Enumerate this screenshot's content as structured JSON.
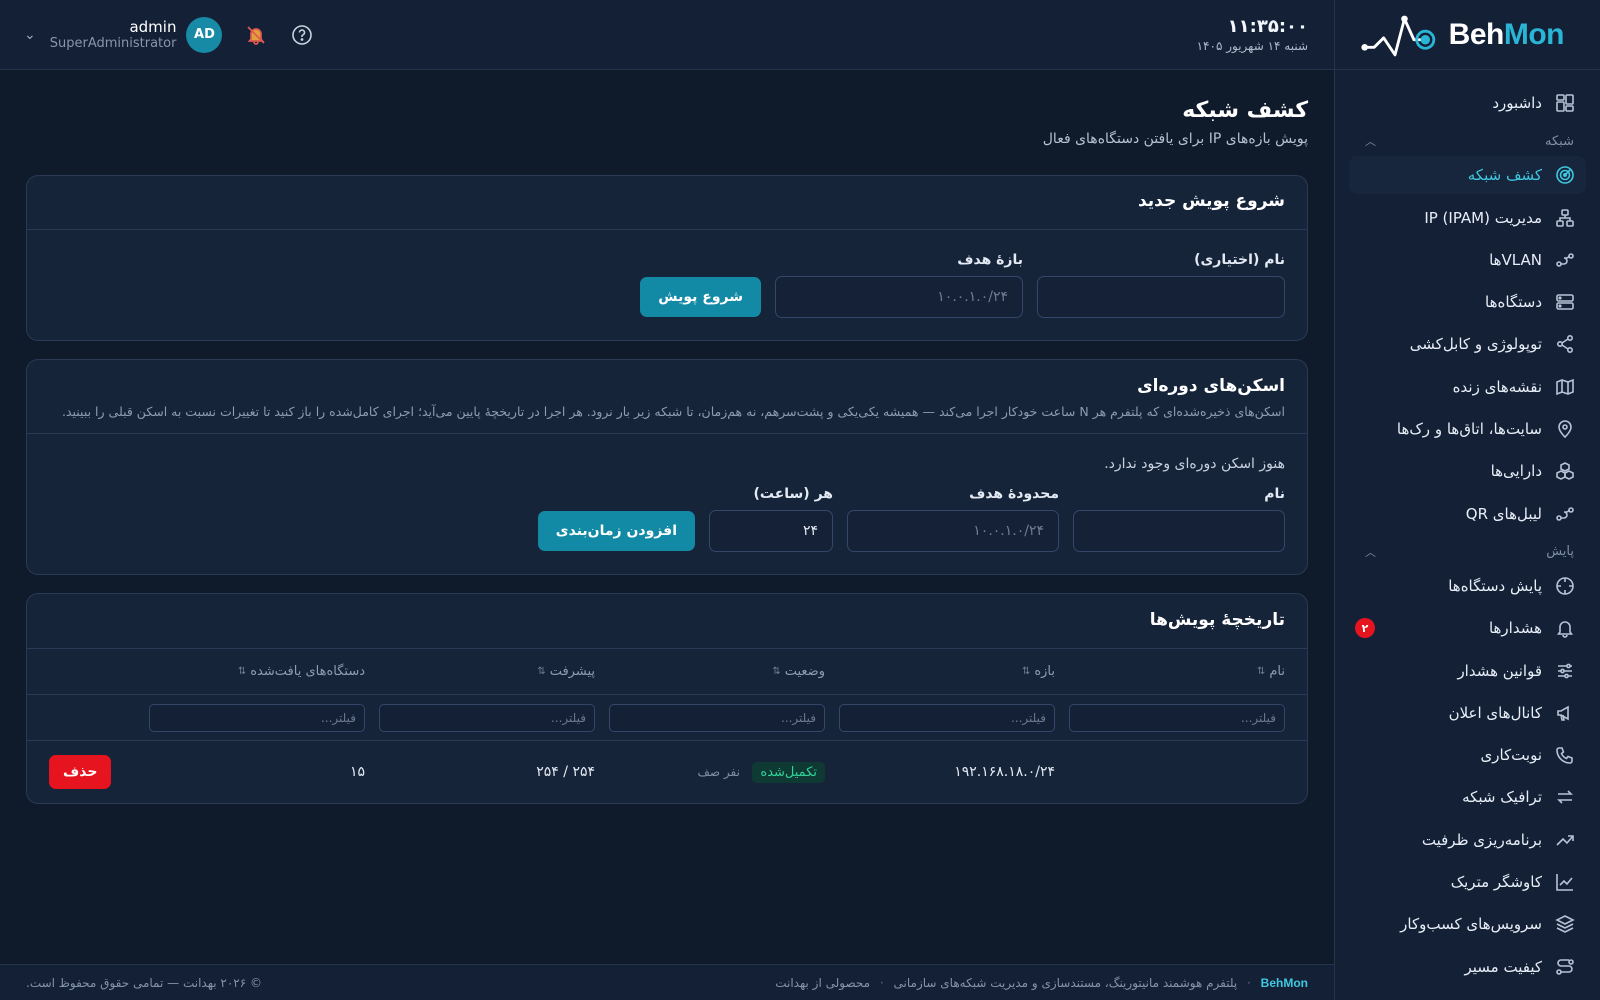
{
  "brand": {
    "part1": "Beh",
    "part2": "Mon"
  },
  "clock": {
    "time": "۱۱:۳۵:۰۰",
    "date": "شنبه ۱۴ شهریور ۱۴۰۵"
  },
  "user": {
    "name": "admin",
    "role": "SuperAdministrator",
    "initials": "AD"
  },
  "nav": {
    "dashboard": "داشبورد",
    "section_network": "شبکه",
    "network_discovery": "کشف شبکه",
    "ipam": "مدیریت IP (IPAM)",
    "vlans": "VLANها",
    "devices": "دستگاه‌ها",
    "topology": "توپولوژی و کابل‌کشی",
    "live_maps": "نقشه‌های زنده",
    "sites": "سایت‌ها، اتاق‌ها و رک‌ها",
    "assets": "دارایی‌ها",
    "qr_labels": "لیبل‌های QR",
    "section_monitoring": "پایش",
    "device_monitoring": "پایش دستگاه‌ها",
    "alerts": "هشدارها",
    "alerts_badge": "۲",
    "alert_rules": "قوانین هشدار",
    "notif_channels": "کانال‌های اعلان",
    "oncall": "نوبت‌کاری",
    "traffic": "ترافیک شبکه",
    "capacity": "برنامه‌ریزی ظرفیت",
    "metric_explorer": "کاوشگر متریک",
    "business_services": "سرویس‌های کسب‌وکار",
    "path_quality": "کیفیت مسیر"
  },
  "page": {
    "title": "کشف شبکه",
    "subtitle": "پویش بازه‌های IP برای یافتن دستگاه‌های فعال"
  },
  "new_scan": {
    "title": "شروع پویش جدید",
    "name_label": "نام (اختیاری)",
    "name_value": "",
    "target_label": "بازهٔ هدف",
    "target_placeholder": "۱۰.۰.۱.۰/۲۴",
    "start_button": "شروع پویش"
  },
  "periodic": {
    "title": "اسکن‌های دوره‌ای",
    "description": "اسکن‌های ذخیره‌شده‌ای که پلتفرم هر N ساعت خودکار اجرا می‌کند — همیشه یکی‌یکی و پشت‌سرهم، نه هم‌زمان، تا شبکه زیر بار نرود. هر اجرا در تاریخچهٔ پایین می‌آید؛ اجرای کامل‌شده را باز کنید تا تغییرات نسبت به اسکن قبلی را ببینید.",
    "empty": "هنوز اسکن دوره‌ای وجود ندارد.",
    "name_label": "نام",
    "name_value": "",
    "target_label": "محدودهٔ هدف",
    "target_placeholder": "۱۰.۰.۱.۰/۲۴",
    "every_label": "هر (ساعت)",
    "every_value": "۲۴",
    "add_button": "افزودن زمان‌بندی"
  },
  "history": {
    "title": "تاریخچهٔ پویش‌ها",
    "columns": [
      "نام",
      "بازه",
      "وضعیت",
      "پیشرفت",
      "دستگاه‌های یافت‌شده"
    ],
    "filter_placeholder": "فیلتر...",
    "rows": [
      {
        "name": "",
        "range": "۱۹۲.۱۶۸.۱۸.۰/۲۴",
        "status": "تکمیل‌شده",
        "queue": "نفر صف",
        "progress": "۲۵۴ / ۲۵۴",
        "found": "۱۵",
        "delete": "حذف"
      }
    ]
  },
  "footer": {
    "brand": "BehMon",
    "tagline": "پلتفرم هوشمند مانیتورینگ، مستندسازی و مدیریت شبکه‌های سازمانی",
    "product": "محصولی از بهدانت",
    "copyright": "© ۲۰۲۶ بهدانت — تمامی حقوق محفوظ است."
  },
  "colors": {
    "accent": "#138aa5",
    "danger": "#e5141f",
    "success": "#32d29a"
  }
}
